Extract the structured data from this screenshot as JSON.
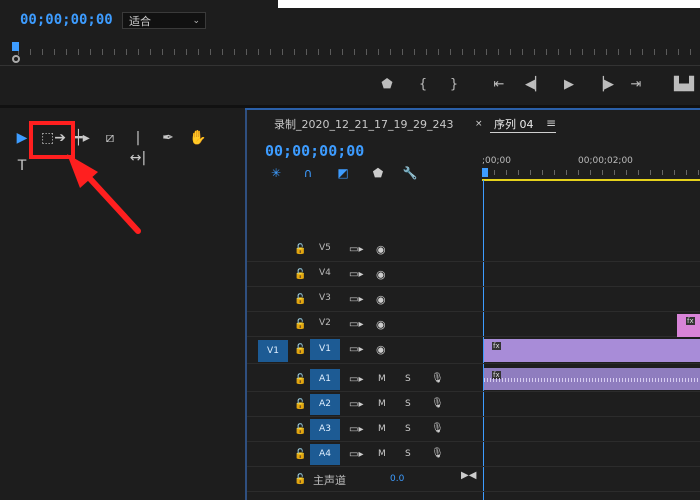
{
  "monitor": {
    "timecode": "00;00;00;00",
    "fit_label": "适合"
  },
  "transport": {
    "buttons": [
      "add-marker",
      "mark-in",
      "mark-out",
      "go-to-in",
      "step-back",
      "play",
      "step-forward",
      "go-to-out",
      "export-frame"
    ]
  },
  "tools": {
    "items": [
      "selection-tool",
      "track-select-tool",
      "ripple-edit-tool",
      "razor-tool",
      "slip-tool",
      "pen-tool",
      "hand-tool",
      "type-tool"
    ]
  },
  "timeline": {
    "tab1": "录制_2020_12_21_17_19_29_243",
    "tab2": "序列 04",
    "tab2_menu": "≡",
    "close": "×",
    "timecode": "00;00;00;00",
    "ruler": [
      ";00;00",
      "00;00;02;00"
    ],
    "video_tracks": [
      "V5",
      "V4",
      "V3",
      "V2",
      "V1"
    ],
    "source_v1": "V1",
    "audio_tracks": [
      "A1",
      "A2",
      "A3",
      "A4"
    ],
    "master_label": "主声道",
    "master_value": "0.0",
    "mute_label": "M",
    "solo_label": "S",
    "fx_label": "fx"
  },
  "colors": {
    "accent": "#3d9cff",
    "highlight": "#ff1f1f",
    "clip": "#a88cd8"
  }
}
